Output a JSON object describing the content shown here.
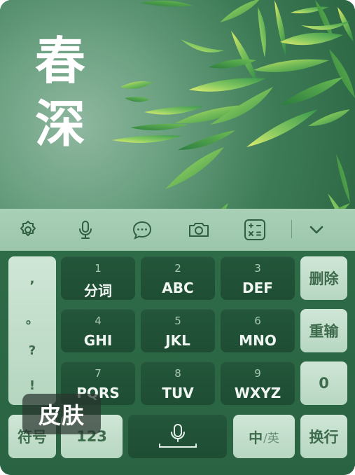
{
  "hero": {
    "title_line1": "春",
    "title_line2": "深"
  },
  "toolbar": {
    "icons": [
      "settings-gear-icon",
      "microphone-icon",
      "chat-bubble-icon",
      "camera-icon",
      "calculator-icon",
      "chevron-down-icon"
    ]
  },
  "keyboard": {
    "punctuation": [
      ",",
      "。",
      "?",
      "!"
    ],
    "keys": [
      {
        "num": "1",
        "letters": "分词"
      },
      {
        "num": "2",
        "letters": "ABC"
      },
      {
        "num": "3",
        "letters": "DEF"
      },
      {
        "num": "4",
        "letters": "GHI"
      },
      {
        "num": "5",
        "letters": "JKL"
      },
      {
        "num": "6",
        "letters": "MNO"
      },
      {
        "num": "7",
        "letters": "PQRS"
      },
      {
        "num": "8",
        "letters": "TUV"
      },
      {
        "num": "9",
        "letters": "WXYZ"
      }
    ],
    "delete_label": "删除",
    "retype_label": "重输",
    "zero_label": "0",
    "symbols_label": "符号",
    "numbers_label": "123",
    "lang_primary": "中",
    "lang_secondary": "/英",
    "newline_label": "换行"
  },
  "skin_badge": "皮肤",
  "colors": {
    "accent_green": "#2e6b47",
    "key_dark": "#1e4d33",
    "key_light": "#cfe6d6",
    "leaf_yellow": "#e8f06a"
  }
}
